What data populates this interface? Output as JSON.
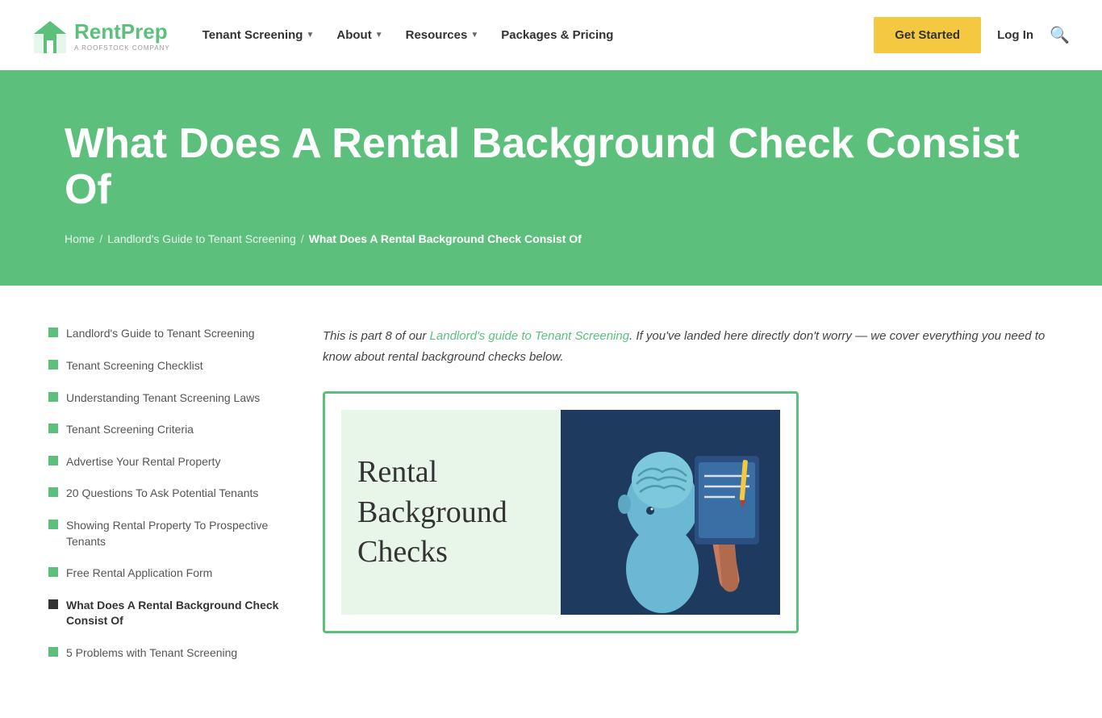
{
  "nav": {
    "logo": {
      "brand_part1": "Rent",
      "brand_part2": "Prep",
      "sub": "A ROOFSTOCK COMPANY"
    },
    "links": [
      {
        "label": "Tenant Screening",
        "has_dropdown": true
      },
      {
        "label": "About",
        "has_dropdown": true
      },
      {
        "label": "Resources",
        "has_dropdown": true
      },
      {
        "label": "Packages & Pricing",
        "has_dropdown": false
      }
    ],
    "get_started": "Get Started",
    "login": "Log In",
    "search_icon": "🔍"
  },
  "hero": {
    "title": "What Does A Rental Background Check Consist Of",
    "breadcrumb": {
      "home": "Home",
      "guide": "Landlord's Guide to Tenant Screening",
      "current": "What Does A Rental Background Check Consist Of"
    }
  },
  "sidebar": {
    "items": [
      {
        "label": "Landlord's Guide to Tenant Screening",
        "active": false
      },
      {
        "label": "Tenant Screening Checklist",
        "active": false
      },
      {
        "label": "Understanding Tenant Screening Laws",
        "active": false
      },
      {
        "label": "Tenant Screening Criteria",
        "active": false
      },
      {
        "label": "Advertise Your Rental Property",
        "active": false
      },
      {
        "label": "20 Questions To Ask Potential Tenants",
        "active": false
      },
      {
        "label": "Showing Rental Property To Prospective Tenants",
        "active": false
      },
      {
        "label": "Free Rental Application Form",
        "active": false
      },
      {
        "label": "What Does A Rental Background Check Consist Of",
        "active": true
      },
      {
        "label": "5 Problems with Tenant Screening",
        "active": false
      }
    ]
  },
  "main": {
    "intro_part1": "This is part 8 of our ",
    "intro_link_text": "Landlord's guide to Tenant Screening",
    "intro_part2": ". If you've landed here directly don't worry — we cover everything you need to know about rental background checks below.",
    "image_lines": [
      "Rental",
      "Background",
      "Checks"
    ]
  },
  "colors": {
    "green": "#5cc07c",
    "yellow": "#f5c842",
    "dark_blue": "#1e3a5f",
    "light_green_bg": "#e8f5e9"
  }
}
